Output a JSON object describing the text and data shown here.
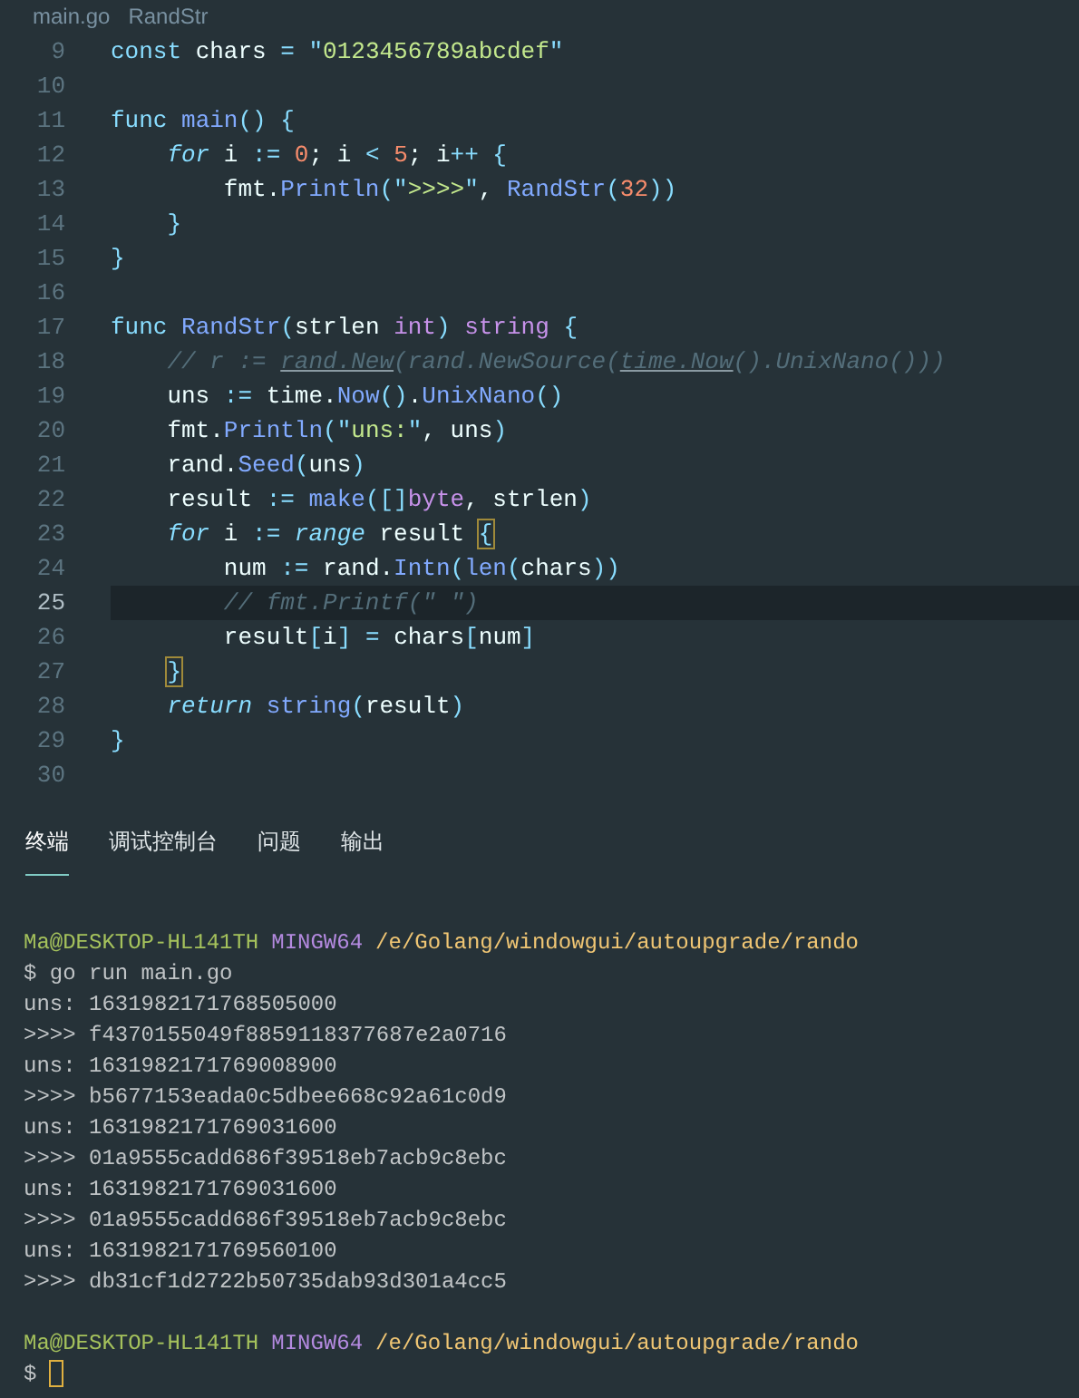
{
  "breadcrumb": {
    "file": "main.go",
    "symbol": "RandStr"
  },
  "editor": {
    "lines": [
      {
        "number": "9",
        "current": false,
        "tokens": [
          {
            "kind": "keyword",
            "text": "const"
          },
          {
            "kind": "plain",
            "text": " chars "
          },
          {
            "kind": "punct",
            "text": "="
          },
          {
            "kind": "punct",
            "text": " \""
          },
          {
            "kind": "string",
            "text": "0123456789abcdef"
          },
          {
            "kind": "punct",
            "text": "\""
          }
        ]
      },
      {
        "number": "10",
        "current": false
      },
      {
        "number": "11",
        "current": false,
        "tokens": [
          {
            "kind": "keyword",
            "text": "func"
          },
          {
            "kind": "function",
            "text": " main"
          },
          {
            "kind": "punct",
            "text": "() {"
          }
        ]
      },
      {
        "number": "12",
        "current": false,
        "tokens": [
          {
            "kind": "control",
            "text": "    for"
          },
          {
            "kind": "plain",
            "text": " i "
          },
          {
            "kind": "punct",
            "text": ":="
          },
          {
            "kind": "number",
            "text": " 0"
          },
          {
            "kind": "plain",
            "text": "; i "
          },
          {
            "kind": "punct",
            "text": "<"
          },
          {
            "kind": "number",
            "text": " 5"
          },
          {
            "kind": "plain",
            "text": "; i"
          },
          {
            "kind": "punct",
            "text": "++ {"
          }
        ]
      },
      {
        "number": "13",
        "current": false,
        "tokens": [
          {
            "kind": "plain",
            "text": "        fmt."
          },
          {
            "kind": "function",
            "text": "Println"
          },
          {
            "kind": "punct",
            "text": "(\""
          },
          {
            "kind": "string",
            "text": ">>>>"
          },
          {
            "kind": "punct",
            "text": "\""
          },
          {
            "kind": "plain",
            "text": ", "
          },
          {
            "kind": "function",
            "text": "RandStr"
          },
          {
            "kind": "punct",
            "text": "("
          },
          {
            "kind": "number",
            "text": "32"
          },
          {
            "kind": "punct",
            "text": "))"
          }
        ]
      },
      {
        "number": "14",
        "current": false,
        "tokens": [
          {
            "kind": "punct",
            "text": "    }"
          }
        ]
      },
      {
        "number": "15",
        "current": false,
        "tokens": [
          {
            "kind": "punct",
            "text": "}"
          }
        ]
      },
      {
        "number": "16",
        "current": false
      },
      {
        "number": "17",
        "current": false,
        "tokens": [
          {
            "kind": "keyword",
            "text": "func"
          },
          {
            "kind": "function",
            "text": " RandStr"
          },
          {
            "kind": "punct",
            "text": "("
          },
          {
            "kind": "plain",
            "text": "strlen "
          },
          {
            "kind": "type",
            "text": "int"
          },
          {
            "kind": "punct",
            "text": ")"
          },
          {
            "kind": "type",
            "text": " string"
          },
          {
            "kind": "punct",
            "text": " {"
          }
        ]
      },
      {
        "number": "18",
        "current": false,
        "tokens": [
          {
            "kind": "comment",
            "text": "    // r := "
          },
          {
            "kind": "comment-underlined",
            "text": "rand.New"
          },
          {
            "kind": "comment",
            "text": "(rand.NewSource("
          },
          {
            "kind": "comment-underlined",
            "text": "time.Now"
          },
          {
            "kind": "comment",
            "text": "().UnixNano()))"
          }
        ]
      },
      {
        "number": "19",
        "current": false,
        "tokens": [
          {
            "kind": "plain",
            "text": "    uns "
          },
          {
            "kind": "punct",
            "text": ":="
          },
          {
            "kind": "plain",
            "text": " time."
          },
          {
            "kind": "function",
            "text": "Now"
          },
          {
            "kind": "punct",
            "text": "()"
          },
          {
            "kind": "plain",
            "text": "."
          },
          {
            "kind": "function",
            "text": "UnixNano"
          },
          {
            "kind": "punct",
            "text": "()"
          }
        ]
      },
      {
        "number": "20",
        "current": false,
        "tokens": [
          {
            "kind": "plain",
            "text": "    fmt."
          },
          {
            "kind": "function",
            "text": "Println"
          },
          {
            "kind": "punct",
            "text": "(\""
          },
          {
            "kind": "string",
            "text": "uns:"
          },
          {
            "kind": "punct",
            "text": "\""
          },
          {
            "kind": "plain",
            "text": ", uns"
          },
          {
            "kind": "punct",
            "text": ")"
          }
        ]
      },
      {
        "number": "21",
        "current": false,
        "tokens": [
          {
            "kind": "plain",
            "text": "    rand."
          },
          {
            "kind": "function",
            "text": "Seed"
          },
          {
            "kind": "punct",
            "text": "("
          },
          {
            "kind": "plain",
            "text": "uns"
          },
          {
            "kind": "punct",
            "text": ")"
          }
        ]
      },
      {
        "number": "22",
        "current": false,
        "tokens": [
          {
            "kind": "plain",
            "text": "    result "
          },
          {
            "kind": "punct",
            "text": ":="
          },
          {
            "kind": "function",
            "text": " make"
          },
          {
            "kind": "punct",
            "text": "([]"
          },
          {
            "kind": "type",
            "text": "byte"
          },
          {
            "kind": "plain",
            "text": ", strlen"
          },
          {
            "kind": "punct",
            "text": ")"
          }
        ]
      },
      {
        "number": "23",
        "current": false,
        "tokens": [
          {
            "kind": "control",
            "text": "    for"
          },
          {
            "kind": "plain",
            "text": " i "
          },
          {
            "kind": "punct",
            "text": ":="
          },
          {
            "kind": "control",
            "text": " range"
          },
          {
            "kind": "plain",
            "text": " result "
          },
          {
            "kind": "bracket-match",
            "text": "{"
          }
        ]
      },
      {
        "number": "24",
        "current": false,
        "tokens": [
          {
            "kind": "plain",
            "text": "        num "
          },
          {
            "kind": "punct",
            "text": ":="
          },
          {
            "kind": "plain",
            "text": " rand."
          },
          {
            "kind": "function",
            "text": "Intn"
          },
          {
            "kind": "punct",
            "text": "("
          },
          {
            "kind": "function",
            "text": "len"
          },
          {
            "kind": "punct",
            "text": "("
          },
          {
            "kind": "plain",
            "text": "chars"
          },
          {
            "kind": "punct",
            "text": "))"
          }
        ]
      },
      {
        "number": "25",
        "current": true,
        "tokens": [
          {
            "kind": "comment",
            "text": "        // fmt.Printf(\" \")"
          }
        ]
      },
      {
        "number": "26",
        "current": false,
        "tokens": [
          {
            "kind": "plain",
            "text": "        result"
          },
          {
            "kind": "punct",
            "text": "["
          },
          {
            "kind": "plain",
            "text": "i"
          },
          {
            "kind": "punct",
            "text": "]"
          },
          {
            "kind": "punct",
            "text": " ="
          },
          {
            "kind": "plain",
            "text": " chars"
          },
          {
            "kind": "punct",
            "text": "["
          },
          {
            "kind": "plain",
            "text": "num"
          },
          {
            "kind": "punct",
            "text": "]"
          }
        ]
      },
      {
        "number": "27",
        "current": false,
        "tokens": [
          {
            "kind": "bracket-match",
            "text": "    }"
          }
        ]
      },
      {
        "number": "28",
        "current": false,
        "tokens": [
          {
            "kind": "control",
            "text": "    return"
          },
          {
            "kind": "function",
            "text": " string"
          },
          {
            "kind": "punct",
            "text": "("
          },
          {
            "kind": "plain",
            "text": "result"
          },
          {
            "kind": "punct",
            "text": ")"
          }
        ]
      },
      {
        "number": "29",
        "current": false,
        "tokens": [
          {
            "kind": "punct",
            "text": "}"
          }
        ]
      },
      {
        "number": "30",
        "current": false
      }
    ]
  },
  "panel_tabs": [
    {
      "label": "终端",
      "selected": true
    },
    {
      "label": "调试控制台",
      "selected": false
    },
    {
      "label": "问题",
      "selected": false
    },
    {
      "label": "输出",
      "selected": false
    }
  ],
  "terminal": {
    "lines": [
      {
        "kind": "prompt",
        "user": "Ma@DESKTOP-HL141TH",
        "system": "MINGW64",
        "path": "/e/Golang/windowgui/autoupgrade/rando"
      },
      {
        "kind": "output",
        "text": "$ go run main.go"
      },
      {
        "kind": "output",
        "text": "uns: 1631982171768505000"
      },
      {
        "kind": "output",
        "text": ">>>> f4370155049f8859118377687e2a0716"
      },
      {
        "kind": "output",
        "text": "uns: 1631982171769008900"
      },
      {
        "kind": "output",
        "text": ">>>> b5677153eada0c5dbee668c92a61c0d9"
      },
      {
        "kind": "output",
        "text": "uns: 1631982171769031600"
      },
      {
        "kind": "output",
        "text": ">>>> 01a9555cadd686f39518eb7acb9c8ebc"
      },
      {
        "kind": "output",
        "text": "uns: 1631982171769031600"
      },
      {
        "kind": "output",
        "text": ">>>> 01a9555cadd686f39518eb7acb9c8ebc"
      },
      {
        "kind": "output",
        "text": "uns: 1631982171769560100"
      },
      {
        "kind": "output",
        "text": ">>>> db31cf1d2722b50735dab93d301a4cc5"
      },
      {
        "kind": "blank"
      },
      {
        "kind": "prompt",
        "user": "Ma@DESKTOP-HL141TH",
        "system": "MINGW64",
        "path": "/e/Golang/windowgui/autoupgrade/rando"
      },
      {
        "kind": "input",
        "text": "$"
      }
    ]
  }
}
